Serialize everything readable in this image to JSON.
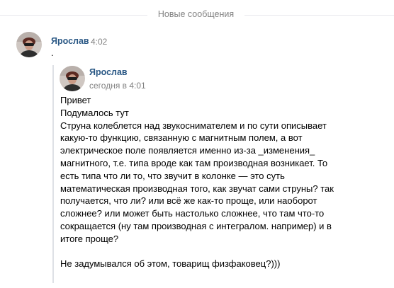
{
  "divider": {
    "label": "Новые сообщения"
  },
  "message": {
    "author": "Ярослав",
    "time": "4:02",
    "text": "."
  },
  "forwarded": {
    "author": "Ярослав",
    "time": "сегодня в 4:01",
    "lines": [
      "Привет",
      "Подумалось тут",
      "Струна колеблется над звукоснимателем и по сути описывает",
      "какую-то функцию, связанную с магнитным полем, а вот",
      "электрическое поле появляется именно из-за _изменения_",
      "магнитного, т.е. типа вроде как там производная возникает. То",
      "есть типа что ли то, что звучит в колонке — это суть",
      "математическая производная того, как звучат сами струны? так",
      "получается, что ли? или всё же как-то проще, или наоборот",
      "сложнее? или может быть настолько сложнее, что там что-то",
      "сокращается (ну там производная с интегралом. например) и в",
      "итоге проще?",
      "",
      "Не задумывался об этом, товарищ физфаковец?)))"
    ]
  },
  "colors": {
    "author": "#2a5885",
    "meta": "#828282",
    "quote_bar": "#dee1e6",
    "divider_line": "#e7e8ec"
  },
  "icons": {
    "avatar": "user-avatar-photo"
  }
}
